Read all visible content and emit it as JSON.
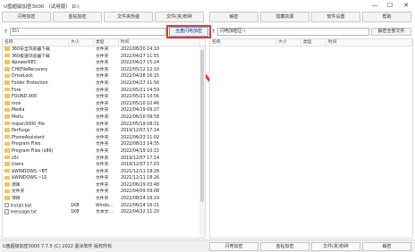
{
  "window": {
    "title": "U盘超级加密3000 （试用版）  D:\\",
    "minimize": "—",
    "maximize": "☐",
    "close": "✕"
  },
  "toolbar_left": [
    "闪电加密",
    "金钻加密",
    "文件夹伪装",
    "文件(夹)粉碎"
  ],
  "toolbar_right": [
    "解密",
    "隐藏资源",
    "软件设置",
    "帮助"
  ],
  "left_path": "D:\\",
  "encrypt_button": "全盘闪电加密",
  "right_path": "闪电加密区:\\",
  "decrypt_all_button": "解密全部文件",
  "left_columns": [
    "名称",
    "大小",
    "类型",
    "时间"
  ],
  "right_columns": [
    "名称",
    "大小",
    "类型",
    "时间"
  ],
  "files": [
    {
      "name": "360安全浏览器下载",
      "size": "",
      "type": "文件夹",
      "time": "2022/08/20 14:10",
      "kind": "folder"
    },
    {
      "name": "360极速浏览器下载",
      "size": "",
      "type": "文件夹",
      "time": "2022/04/27 11:55",
      "kind": "folder"
    },
    {
      "name": "ApowerREC",
      "size": "",
      "type": "文件夹",
      "time": "2022/04/27 15:24",
      "kind": "folder"
    },
    {
      "name": "CHKFileRecovery",
      "size": "",
      "type": "文件夹",
      "time": "2022/05/12 12:10",
      "kind": "folder"
    },
    {
      "name": "DriveLock",
      "size": "",
      "type": "文件夹",
      "time": "2022/04/28 16:15",
      "kind": "folder"
    },
    {
      "name": "Folder Protection",
      "size": "",
      "type": "文件夹",
      "time": "2022/04/27 11:56",
      "kind": "folder"
    },
    {
      "name": "Fore",
      "size": "",
      "type": "文件夹",
      "time": "2022/05/21 14:59",
      "kind": "folder"
    },
    {
      "name": "FOUND.000",
      "size": "",
      "type": "文件夹",
      "time": "2022/05/21 10:56",
      "kind": "folder"
    },
    {
      "name": "mce",
      "size": "",
      "type": "文件夹",
      "time": "2022/05/10 10:46",
      "kind": "folder"
    },
    {
      "name": "Media",
      "size": "",
      "type": "文件夹",
      "time": "2022/04/19 09:27",
      "kind": "folder"
    },
    {
      "name": "Meitu",
      "size": "",
      "type": "文件夹",
      "time": "2022/06/10 09:58",
      "kind": "folder"
    },
    {
      "name": "mipan3000_file",
      "size": "",
      "type": "文件夹",
      "time": "2022/05/19 08:31",
      "kind": "folder"
    },
    {
      "name": "PerfLogs",
      "size": "",
      "type": "文件夹",
      "time": "2019/12/07 17:14",
      "kind": "folder"
    },
    {
      "name": "PhoneAssistant",
      "size": "",
      "type": "文件夹",
      "time": "2022/06/23 11:02",
      "kind": "folder"
    },
    {
      "name": "Program Files",
      "size": "",
      "type": "文件夹",
      "time": "2022/08/23 14:35",
      "kind": "folder"
    },
    {
      "name": "Program Files (x86)",
      "size": "",
      "type": "文件夹",
      "time": "2022/04/19 10:15",
      "kind": "folder"
    },
    {
      "name": "s5c",
      "size": "",
      "type": "文件夹",
      "time": "2019/12/07 17:14",
      "kind": "folder"
    },
    {
      "name": "Users",
      "size": "",
      "type": "文件夹",
      "time": "2019/12/07 17:03",
      "kind": "folder"
    },
    {
      "name": "$WINDOWS.~BT",
      "size": "",
      "type": "文件夹",
      "time": "2021/12/11 18:28",
      "kind": "folder"
    },
    {
      "name": "$WINDOWS.~LS",
      "size": "",
      "type": "文件夹",
      "time": "2021/12/11 18:26",
      "kind": "folder"
    },
    {
      "name": "源库",
      "size": "",
      "type": "文件夹",
      "time": "2022/06/19 03:48",
      "kind": "folder"
    },
    {
      "name": "文件夹",
      "size": "",
      "type": "文件夹",
      "time": "2022/04/09 09:08",
      "kind": "folder"
    },
    {
      "name": "项目",
      "size": "",
      "type": "文件夹",
      "time": "2022/08/24 16:19",
      "kind": "folder"
    },
    {
      "name": "Install.bat",
      "size": "1KB",
      "type": "Windo...",
      "time": "2022/06/14 16:31",
      "kind": "file"
    },
    {
      "name": "message.txt",
      "size": "1KB",
      "type": "文本文...",
      "time": "2022/04/22 11:20",
      "kind": "file"
    }
  ],
  "status": {
    "text": "U盘超级加密3000 7.7.5 (C) 2022 夏冰软件 版权所有",
    "buttons": [
      "闪电加密",
      "金钻加密",
      "文件(夹)粉碎",
      "解密"
    ]
  }
}
